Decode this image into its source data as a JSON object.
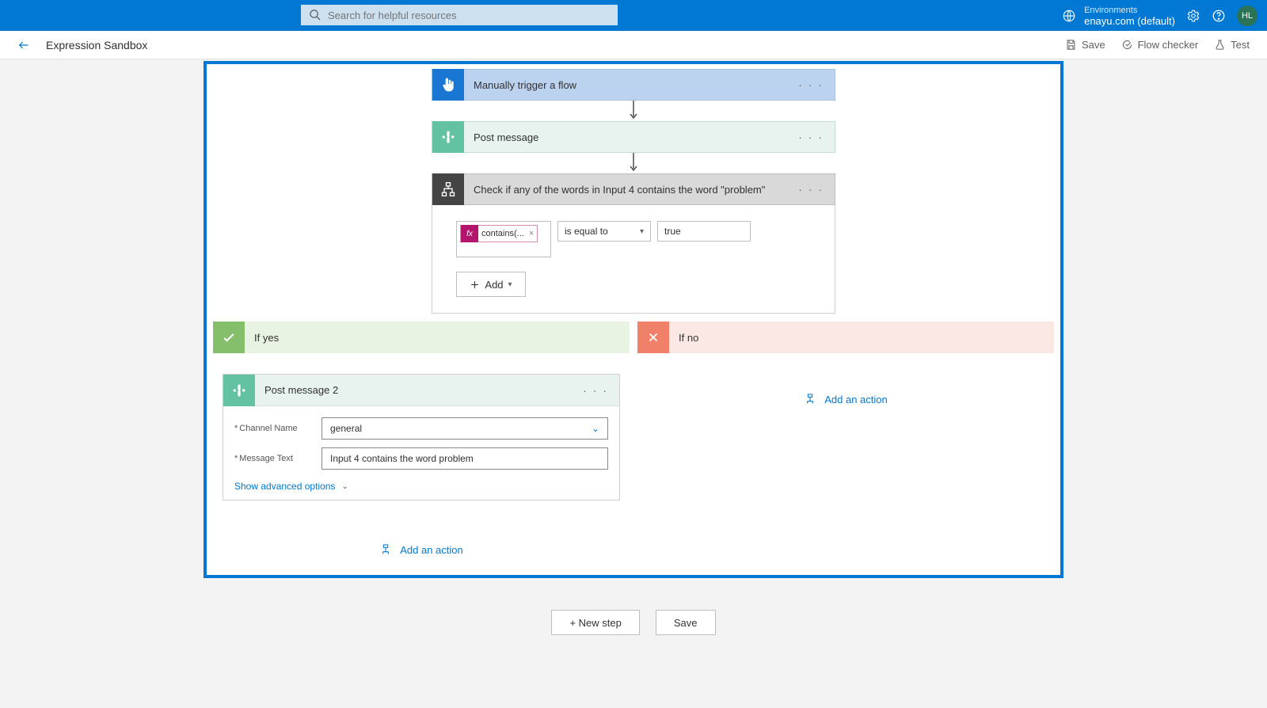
{
  "header": {
    "search_placeholder": "Search for helpful resources",
    "env_label": "Environments",
    "env_name": "enayu.com (default)",
    "avatar_initials": "HL"
  },
  "toolbar": {
    "page_title": "Expression Sandbox",
    "save": "Save",
    "flow_checker": "Flow checker",
    "test": "Test"
  },
  "flow": {
    "trigger": {
      "title": "Manually trigger a flow"
    },
    "step2": {
      "title": "Post message"
    },
    "condition": {
      "title": "Check if any of the words in Input 4 contains the word \"problem\"",
      "token_label": "contains(...",
      "operator": "is equal to",
      "value": "true",
      "add_label": "Add"
    },
    "yes": {
      "title": "If yes",
      "action": {
        "title": "Post message 2",
        "channel_label": "Channel Name",
        "channel_value": "general",
        "message_label": "Message Text",
        "message_value": "Input 4 contains the word problem",
        "advanced": "Show advanced options"
      },
      "add_action": "Add an action"
    },
    "no": {
      "title": "If no",
      "add_action": "Add an action"
    }
  },
  "footer": {
    "new_step": "+ New step",
    "save": "Save"
  }
}
